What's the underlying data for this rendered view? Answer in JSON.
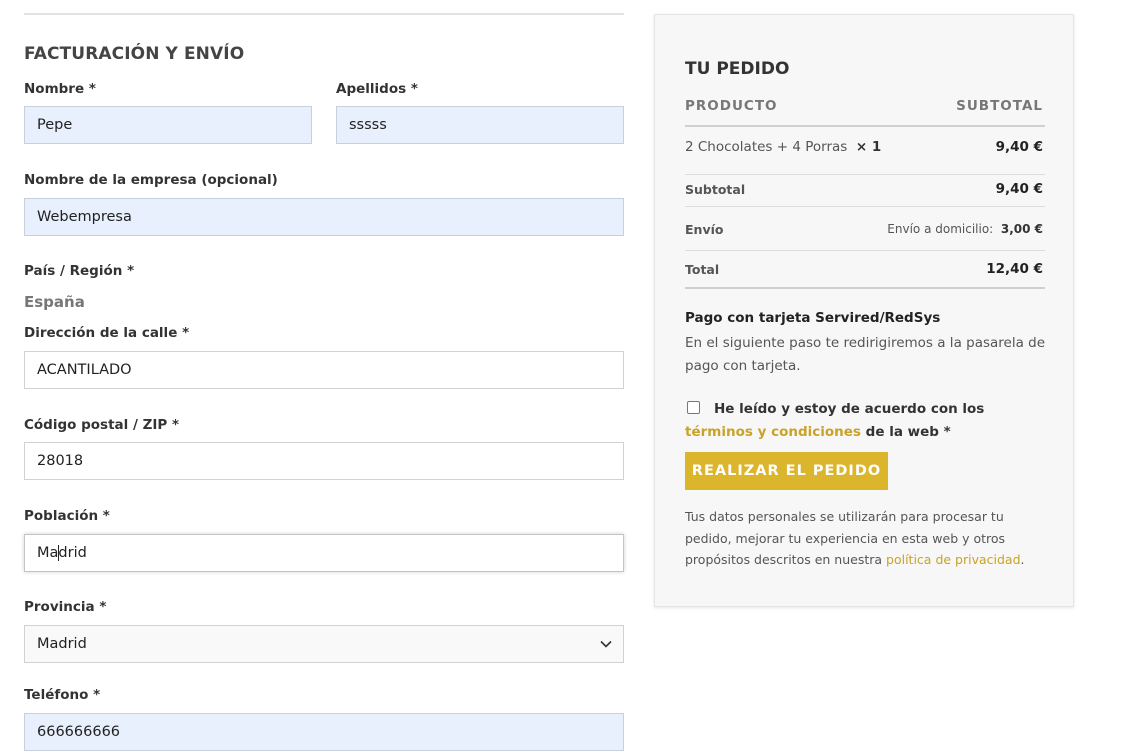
{
  "billing": {
    "title": "FACTURACIÓN Y ENVÍO",
    "first_name": {
      "label": "Nombre",
      "value": "Pepe"
    },
    "last_name": {
      "label": "Apellidos",
      "value": "sssss"
    },
    "company": {
      "label": "Nombre de la empresa (opcional)",
      "value": "Webempresa"
    },
    "country": {
      "label": "País / Región",
      "value": "España"
    },
    "address": {
      "label": "Dirección de la calle",
      "value": "ACANTILADO"
    },
    "postcode": {
      "label": "Código postal / ZIP",
      "value": "28018"
    },
    "city": {
      "label": "Población",
      "value_before_caret": "Ma",
      "value_after_caret": "drid"
    },
    "province": {
      "label": "Provincia",
      "value": "Madrid"
    },
    "phone": {
      "label": "Teléfono",
      "value": "666666666"
    },
    "required_mark": "*"
  },
  "order": {
    "title": "TU PEDIDO",
    "col_product": "PRODUCTO",
    "col_subtotal": "SUBTOTAL",
    "item": {
      "name": "2 Chocolates + 4 Porras",
      "qty": "× 1",
      "price": "9,40 €"
    },
    "subtotal": {
      "label": "Subtotal",
      "value": "9,40 €"
    },
    "shipping": {
      "label": "Envío",
      "method": "Envío a domicilio:",
      "value": "3,00 €"
    },
    "total": {
      "label": "Total",
      "value": "12,40 €"
    }
  },
  "payment": {
    "title": "Pago con tarjeta Servired/RedSys",
    "description": "En el siguiente paso te redirigiremos a la pasarela de pago con tarjeta."
  },
  "terms": {
    "before": "He leído y estoy de acuerdo con los",
    "link": "términos y condiciones",
    "after": "de la web",
    "required": "*"
  },
  "place_order_label": "REALIZAR EL PEDIDO",
  "privacy": {
    "text": "Tus datos personales se utilizarán para procesar tu pedido, mejorar tu experiencia en esta web y otros propósitos descritos en nuestra",
    "link": "política de privacidad",
    "end": "."
  }
}
